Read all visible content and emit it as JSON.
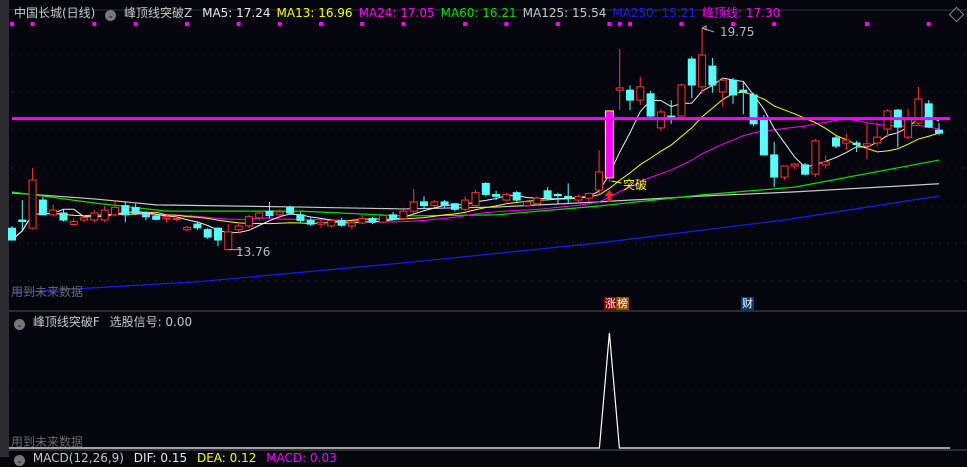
{
  "header": {
    "stock": "中国长城(日线)",
    "indicator": "峰顶线突破Z",
    "items": [
      {
        "label": "MA5: 17.24",
        "color": "#e8e8e8"
      },
      {
        "label": "MA13: 16.96",
        "color": "#ffff00"
      },
      {
        "label": "MA24: 17.05",
        "color": "#ff00ff"
      },
      {
        "label": "MA60: 16.21",
        "color": "#00e000"
      },
      {
        "label": "MA125: 15.54",
        "color": "#c8c8c8"
      },
      {
        "label": "MA250: 15.21",
        "color": "#1a1aff"
      },
      {
        "label": "峰顶线: 17.30",
        "color": "#ff00ff"
      }
    ]
  },
  "annotations": {
    "high_label": "19.75",
    "low_label": "13.76",
    "breakout_label": "突破",
    "future_data_main": "用到未来数据",
    "future_data_sub": "用到未来数据",
    "tag_zhang": "涨",
    "tag_bang": "榜",
    "tag_cai": "财"
  },
  "sub_panel": {
    "indicator": "峰顶线突破F",
    "signal_label": "选股信号: 0.00"
  },
  "macd_panel": {
    "label": "MACD(12,26,9)",
    "dif": "DIF: 0.15",
    "dea": "DEA: 0.12",
    "macd": "MACD: 0.03"
  },
  "chart_data": {
    "type": "candlestick",
    "price_range": [
      12.4,
      19.75
    ],
    "peak_line": 17.3,
    "high": {
      "index": 67,
      "value": 19.75
    },
    "low": {
      "index": 21,
      "value": 13.76
    },
    "breakout_index": 58,
    "signal_index": 58,
    "top_marker_indices": [
      0,
      2,
      8,
      12,
      17,
      22,
      26,
      30,
      34,
      38,
      44,
      48,
      53,
      58,
      59,
      60,
      65,
      70,
      74,
      83,
      89
    ],
    "tag_indices": {
      "zhang_bang": 58,
      "cai": 71
    },
    "candles_ohlc": [
      [
        14.34,
        14.4,
        14.02,
        14.02
      ],
      [
        14.56,
        15.1,
        14.29,
        14.52
      ],
      [
        14.34,
        15.97,
        14.3,
        15.64
      ],
      [
        15.1,
        15.18,
        14.7,
        14.7
      ],
      [
        14.7,
        14.97,
        14.65,
        14.83
      ],
      [
        14.75,
        14.85,
        14.52,
        14.56
      ],
      [
        14.44,
        14.6,
        14.4,
        14.52
      ],
      [
        14.56,
        14.7,
        14.5,
        14.62
      ],
      [
        14.56,
        14.83,
        14.5,
        14.75
      ],
      [
        14.56,
        14.95,
        14.5,
        14.83
      ],
      [
        14.7,
        15.1,
        14.65,
        14.9
      ],
      [
        14.95,
        15.05,
        14.5,
        14.7
      ],
      [
        14.9,
        15.0,
        14.7,
        14.75
      ],
      [
        14.75,
        14.8,
        14.55,
        14.65
      ],
      [
        14.67,
        14.72,
        14.55,
        14.58
      ],
      [
        14.6,
        14.7,
        14.5,
        14.65
      ],
      [
        14.6,
        14.68,
        14.52,
        14.6
      ],
      [
        14.3,
        14.4,
        14.25,
        14.36
      ],
      [
        14.45,
        14.5,
        14.3,
        14.35
      ],
      [
        14.3,
        14.35,
        14.05,
        14.1
      ],
      [
        14.34,
        14.36,
        13.85,
        14.02
      ],
      [
        13.76,
        14.45,
        13.76,
        14.24
      ],
      [
        14.3,
        14.45,
        14.2,
        14.4
      ],
      [
        14.4,
        14.7,
        14.35,
        14.65
      ],
      [
        14.62,
        14.8,
        14.55,
        14.75
      ],
      [
        14.8,
        15.05,
        14.6,
        14.68
      ],
      [
        14.7,
        14.85,
        14.6,
        14.78
      ],
      [
        14.9,
        14.95,
        14.7,
        14.75
      ],
      [
        14.7,
        14.78,
        14.5,
        14.55
      ],
      [
        14.55,
        14.65,
        14.4,
        14.45
      ],
      [
        14.45,
        14.55,
        14.35,
        14.5
      ],
      [
        14.4,
        14.6,
        14.35,
        14.55
      ],
      [
        14.55,
        14.62,
        14.38,
        14.42
      ],
      [
        14.4,
        14.52,
        14.3,
        14.48
      ],
      [
        14.48,
        14.7,
        14.45,
        14.6
      ],
      [
        14.6,
        14.65,
        14.45,
        14.5
      ],
      [
        14.5,
        14.7,
        14.48,
        14.68
      ],
      [
        14.7,
        14.78,
        14.55,
        14.58
      ],
      [
        14.6,
        14.85,
        14.55,
        14.8
      ],
      [
        14.8,
        15.4,
        14.75,
        15.05
      ],
      [
        15.05,
        15.2,
        14.85,
        14.95
      ],
      [
        14.95,
        15.1,
        14.9,
        15.05
      ],
      [
        15.05,
        15.1,
        14.88,
        14.95
      ],
      [
        15.0,
        15.02,
        14.8,
        14.85
      ],
      [
        14.85,
        15.2,
        14.8,
        15.1
      ],
      [
        14.95,
        15.38,
        14.93,
        15.3
      ],
      [
        15.55,
        15.58,
        15.2,
        15.25
      ],
      [
        15.25,
        15.35,
        15.1,
        15.2
      ],
      [
        15.1,
        15.3,
        15.05,
        15.25
      ],
      [
        15.3,
        15.34,
        15.05,
        15.1
      ],
      [
        14.95,
        15.1,
        14.92,
        15.05
      ],
      [
        15.0,
        15.2,
        14.95,
        15.15
      ],
      [
        15.35,
        15.45,
        15.1,
        15.15
      ],
      [
        15.25,
        15.3,
        15.0,
        15.22
      ],
      [
        15.2,
        15.55,
        15.0,
        15.15
      ],
      [
        15.1,
        15.25,
        15.05,
        15.2
      ],
      [
        15.15,
        15.3,
        15.05,
        15.28
      ],
      [
        15.37,
        16.45,
        15.24,
        15.86
      ],
      [
        15.7,
        17.51,
        15.59,
        17.51
      ],
      [
        18.07,
        19.18,
        17.53,
        18.13
      ],
      [
        18.07,
        18.2,
        17.53,
        17.8
      ],
      [
        17.8,
        18.43,
        17.67,
        18.16
      ],
      [
        17.97,
        18.05,
        17.32,
        17.37
      ],
      [
        17.05,
        17.55,
        16.97,
        17.48
      ],
      [
        17.37,
        17.8,
        17.16,
        17.32
      ],
      [
        17.37,
        18.25,
        17.37,
        18.21
      ],
      [
        18.91,
        18.98,
        17.85,
        18.21
      ],
      [
        18.16,
        19.75,
        17.97,
        19.02
      ],
      [
        18.72,
        18.94,
        18.0,
        18.21
      ],
      [
        18.02,
        18.4,
        17.62,
        18.34
      ],
      [
        18.34,
        18.4,
        17.7,
        17.94
      ],
      [
        18.07,
        18.29,
        17.42,
        18.02
      ],
      [
        17.94,
        18.0,
        17.1,
        17.16
      ],
      [
        17.32,
        17.4,
        16.3,
        16.32
      ],
      [
        16.32,
        16.67,
        15.45,
        15.72
      ],
      [
        15.72,
        16.02,
        15.64,
        16.02
      ],
      [
        16.02,
        16.1,
        15.92,
        16.07
      ],
      [
        16.05,
        16.1,
        15.77,
        15.8
      ],
      [
        15.8,
        16.75,
        15.72,
        16.7
      ],
      [
        16.05,
        16.3,
        15.95,
        16.13
      ],
      [
        16.78,
        16.85,
        16.5,
        16.56
      ],
      [
        16.64,
        16.9,
        16.45,
        16.72
      ],
      [
        16.64,
        16.7,
        16.4,
        16.6
      ],
      [
        16.56,
        17.21,
        16.2,
        16.62
      ],
      [
        16.64,
        17.2,
        16.55,
        16.8
      ],
      [
        17.02,
        17.55,
        16.8,
        17.51
      ],
      [
        17.53,
        17.56,
        16.53,
        17.07
      ],
      [
        16.8,
        17.56,
        16.75,
        17.32
      ],
      [
        17.18,
        18.16,
        17.1,
        17.83
      ],
      [
        17.7,
        17.8,
        17.05,
        17.07
      ],
      [
        16.99,
        17.18,
        16.85,
        16.91
      ]
    ],
    "ma60_points": [
      [
        0,
        15.32
      ],
      [
        8,
        15.02
      ],
      [
        15,
        14.8
      ],
      [
        28,
        14.8
      ],
      [
        38,
        14.67
      ],
      [
        47,
        14.7
      ],
      [
        57,
        14.94
      ],
      [
        67,
        15.24
      ],
      [
        76,
        15.45
      ],
      [
        90,
        16.18
      ]
    ],
    "ma125_points": [
      [
        0,
        15.29
      ],
      [
        8,
        15.13
      ],
      [
        14,
        14.97
      ],
      [
        28,
        14.91
      ],
      [
        38,
        14.86
      ],
      [
        47,
        14.91
      ],
      [
        57,
        15.05
      ],
      [
        67,
        15.21
      ],
      [
        76,
        15.32
      ],
      [
        90,
        15.54
      ]
    ],
    "ma250_points": [
      [
        0,
        12.6
      ],
      [
        18,
        12.89
      ],
      [
        38,
        13.4
      ],
      [
        57,
        13.94
      ],
      [
        75,
        14.56
      ],
      [
        90,
        15.21
      ]
    ]
  }
}
